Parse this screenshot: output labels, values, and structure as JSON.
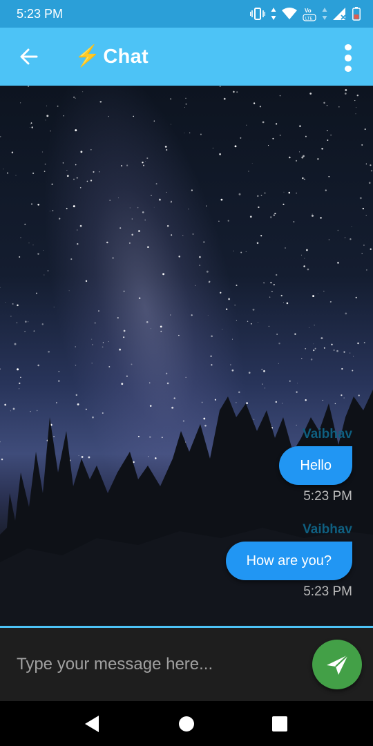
{
  "status_bar": {
    "time": "5:23 PM",
    "icons": [
      "vibrate-icon",
      "data-arrows-icon",
      "wifi-icon",
      "volte-icon",
      "signal-icon",
      "battery-icon"
    ],
    "background": "#2b9fd8"
  },
  "app_bar": {
    "title": "Chat",
    "title_icon": "⚡",
    "background": "#4dc3f6"
  },
  "messages": [
    {
      "sender": "Vaibhav",
      "text": "Hello",
      "time": "5:23 PM"
    },
    {
      "sender": "Vaibhav",
      "text": "How are you?",
      "time": "5:23 PM"
    }
  ],
  "composer": {
    "placeholder": "Type your message here...",
    "send_icon": "send-icon",
    "send_color": "#43a047"
  },
  "nav_bar": {
    "buttons": [
      "back-triangle-icon",
      "home-circle-icon",
      "recents-square-icon"
    ]
  },
  "colors": {
    "bubble": "#2196f3",
    "sender": "#0f5f80"
  }
}
